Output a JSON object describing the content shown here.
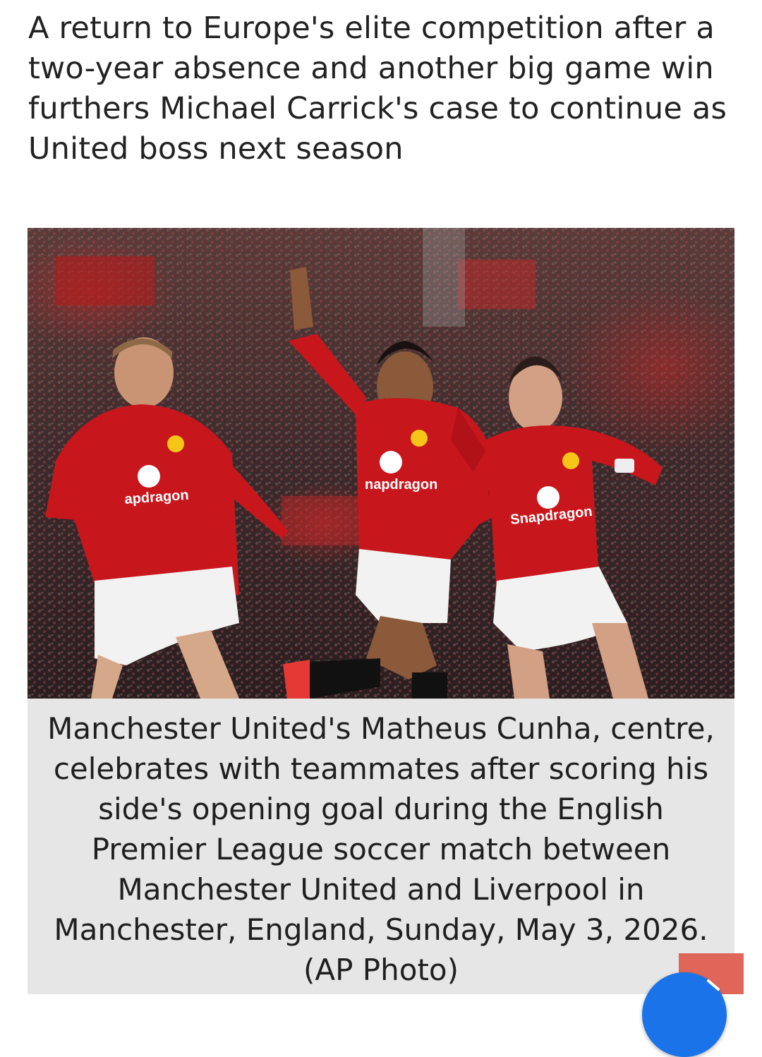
{
  "article": {
    "subheadline": "A return to Europe's elite competition after a two-year absence and another big game win furthers Michael Carrick's case to continue as United boss next season"
  },
  "photo": {
    "alt": "Manchester United players celebrating a goal",
    "sponsor_text": "Snapdragon",
    "sponsor_text_cropped_left": "napdragon",
    "sponsor_text_cropped_center": "apdragon",
    "colors": {
      "kit_red": "#c8161d",
      "shorts_white": "#f2f2f2",
      "crowd_dark": "#3a2a2a"
    }
  },
  "caption": {
    "text": "Manchester United's Matheus Cunha, centre, celebrates with teammates after scoring his side's opening goal during the English Premier League soccer match between Manchester United and Liverpool in Manchester, England, Sunday, May 3, 2026. (AP Photo)"
  },
  "widgets": {
    "corner_color": "#e0665a",
    "fab_color": "#1a73e8",
    "fab_icon": "chevron-icon"
  }
}
